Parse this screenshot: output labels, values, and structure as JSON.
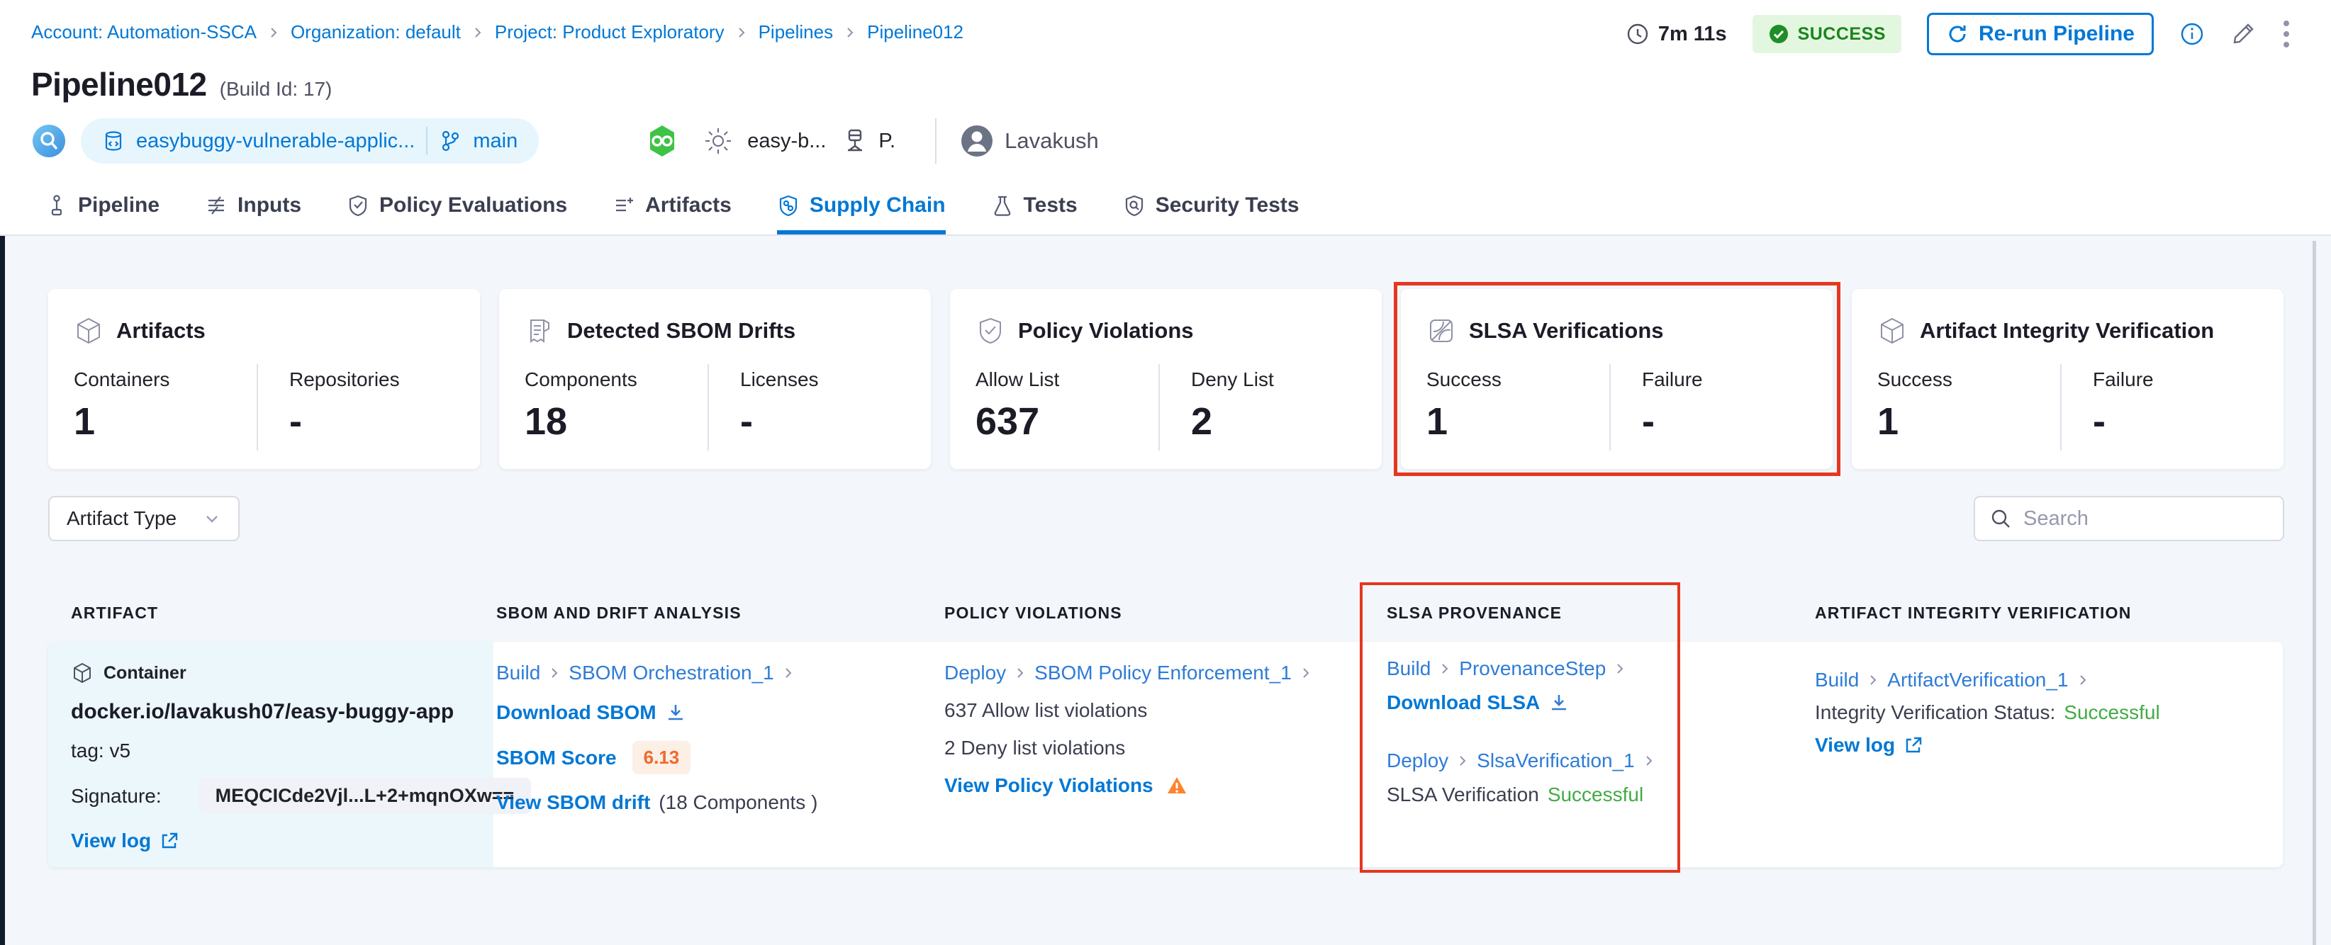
{
  "breadcrumb": {
    "items": [
      "Account: Automation-SSCA",
      "Organization: default",
      "Project: Product Exploratory",
      "Pipelines",
      "Pipeline012"
    ]
  },
  "header": {
    "duration": "7m 11s",
    "status": "SUCCESS",
    "rerun_label": "Re-run Pipeline",
    "title": "Pipeline012",
    "build_id": "(Build Id: 17)",
    "repo": "easybuggy-vulnerable-applic...",
    "branch": "main",
    "trigger_label": "easy-b...",
    "trigger_suffix": "P.",
    "user": "Lavakush"
  },
  "tabs": [
    {
      "label": "Pipeline",
      "active": false
    },
    {
      "label": "Inputs",
      "active": false
    },
    {
      "label": "Policy Evaluations",
      "active": false
    },
    {
      "label": "Artifacts",
      "active": false
    },
    {
      "label": "Supply Chain",
      "active": true
    },
    {
      "label": "Tests",
      "active": false
    },
    {
      "label": "Security Tests",
      "active": false
    }
  ],
  "summary_cards": [
    {
      "title": "Artifacts",
      "icon": "cube-icon",
      "highlighted": false,
      "stats": [
        {
          "label": "Containers",
          "value": "1"
        },
        {
          "label": "Repositories",
          "value": "-"
        }
      ]
    },
    {
      "title": "Detected SBOM Drifts",
      "icon": "sbom-document-icon",
      "highlighted": false,
      "stats": [
        {
          "label": "Components",
          "value": "18"
        },
        {
          "label": "Licenses",
          "value": "-"
        }
      ]
    },
    {
      "title": "Policy Violations",
      "icon": "shield-check-icon",
      "highlighted": false,
      "stats": [
        {
          "label": "Allow List",
          "value": "637"
        },
        {
          "label": "Deny List",
          "value": "2"
        }
      ]
    },
    {
      "title": "SLSA Verifications",
      "icon": "slsa-badge-icon",
      "highlighted": true,
      "stats": [
        {
          "label": "Success",
          "value": "1"
        },
        {
          "label": "Failure",
          "value": "-"
        }
      ]
    },
    {
      "title": "Artifact Integrity Verification",
      "icon": "cube-icon",
      "highlighted": false,
      "stats": [
        {
          "label": "Success",
          "value": "1"
        },
        {
          "label": "Failure",
          "value": "-"
        }
      ]
    }
  ],
  "filters": {
    "artifact_type_label": "Artifact Type",
    "search_placeholder": "Search"
  },
  "table": {
    "columns": [
      "ARTIFACT",
      "SBOM AND DRIFT ANALYSIS",
      "POLICY VIOLATIONS",
      "SLSA PROVENANCE",
      "ARTIFACT INTEGRITY VERIFICATION"
    ],
    "row": {
      "artifact": {
        "type_label": "Container",
        "image": "docker.io/lavakush07/easy-buggy-app",
        "tag": "tag: v5",
        "signature_label": "Signature:",
        "signature": "MEQCICde2Vjl...L+2+mqnOXw==",
        "view_log": "View log"
      },
      "sbom": {
        "stage": "Build",
        "step": "SBOM Orchestration_1",
        "download": "Download SBOM",
        "score_label": "SBOM Score",
        "score": "6.13",
        "drift_link": "View SBOM drift",
        "drift_info": "(18 Components )"
      },
      "policy": {
        "stage": "Deploy",
        "step": "SBOM Policy Enforcement_1",
        "allow": "637 Allow list violations",
        "deny": "2 Deny list violations",
        "view": "View Policy Violations"
      },
      "slsa": {
        "stage1": "Build",
        "step1": "ProvenanceStep",
        "download": "Download SLSA",
        "stage2": "Deploy",
        "step2": "SlsaVerification_1",
        "status_label": "SLSA Verification",
        "status_value": "Successful"
      },
      "integrity": {
        "stage": "Build",
        "step": "ArtifactVerification_1",
        "status_label": "Integrity Verification Status:",
        "status_value": "Successful",
        "view_log": "View log"
      }
    }
  },
  "colors": {
    "accent_blue": "#0278d5",
    "link_blue": "#2e7cd6",
    "success_badge_bg": "#e3f7e0",
    "success_badge_text": "#1b841d",
    "success_green": "#42ab45",
    "highlight_red": "#e5371f",
    "warning_orange": "#ff832b",
    "score_orange": "#f06a2b",
    "artifact_cell_bg": "#ecf7fb",
    "page_bg": "#f3f6fa"
  }
}
